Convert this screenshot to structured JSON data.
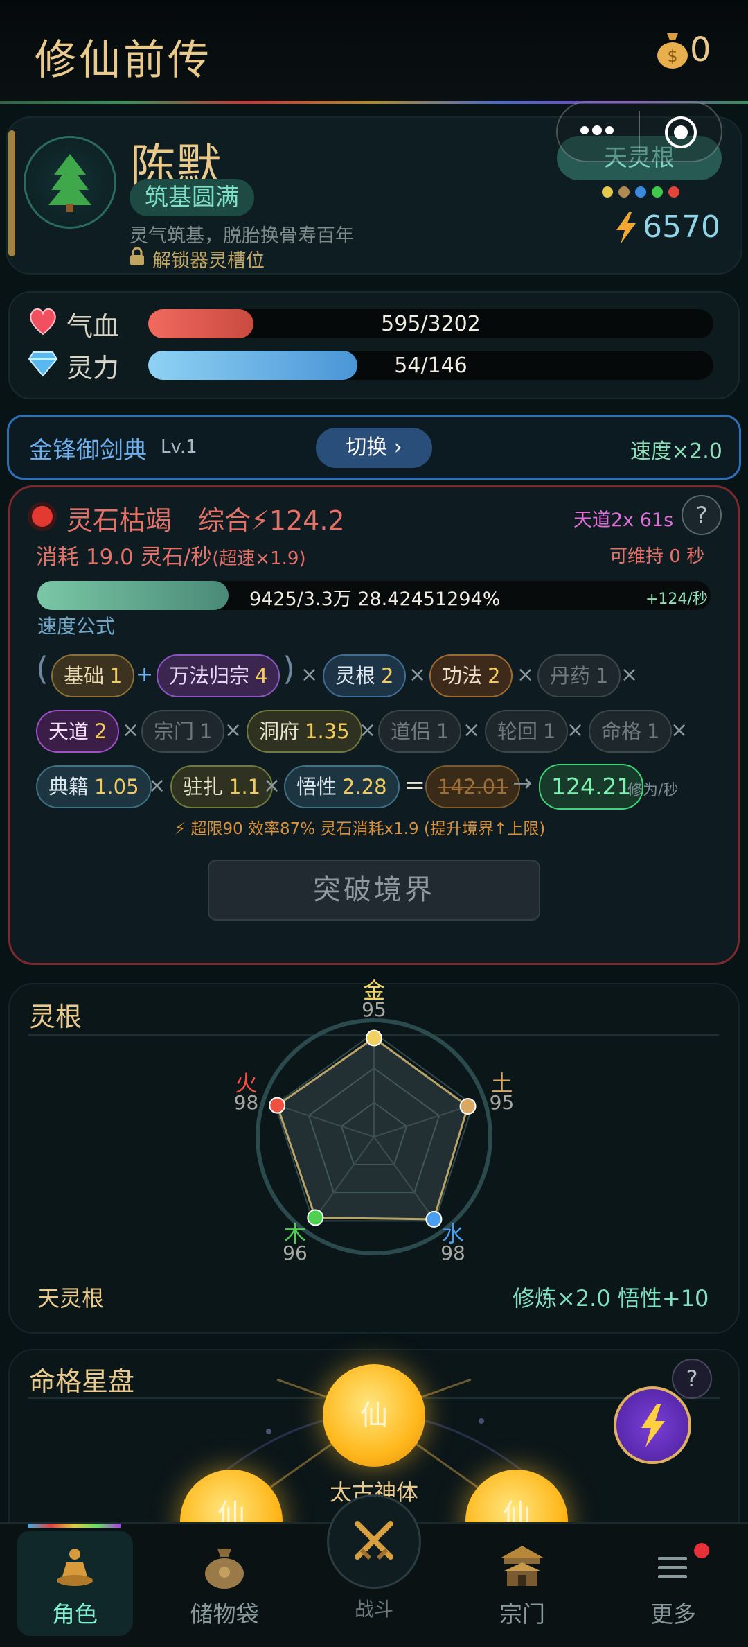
{
  "header": {
    "title": "修仙前传",
    "coins": "0",
    "coin_icon": "money-bag-icon"
  },
  "capsule": {
    "menu_icon": "more-dots-icon",
    "close_icon": "target-icon"
  },
  "character": {
    "name": "陈默",
    "realm": "筑基圆满",
    "realm_desc": "灵气筑基，脱胎换骨寿百年",
    "unlock_text": "解锁器灵槽位",
    "linggen_badge": "天灵根",
    "power": "6570",
    "element_dot_colors": [
      "#e6c84a",
      "#b08a50",
      "#3a8ae0",
      "#3fc84a",
      "#e0443a"
    ]
  },
  "stats": {
    "hp_label": "气血",
    "hp_value": "595/3202",
    "hp_ratio": 0.186,
    "mp_label": "灵力",
    "mp_value": "54/146",
    "mp_ratio": 0.37
  },
  "skill": {
    "name": "金锋御剑典",
    "level": "Lv.1",
    "switch_label": "切换 ›",
    "speed": "速度×2.0"
  },
  "cultivation": {
    "status": "灵石枯竭",
    "overall_label": "综合",
    "overall_value": "124.2",
    "tiandao_timer": "天道2x 61s",
    "help": "?",
    "consume_main": "消耗 19.0 灵石/秒",
    "consume_extra": "(超速×1.9)",
    "sustain": "可维持 0 秒",
    "progress_text": "9425/3.3万  28.42451294%",
    "progress_ratio": 0.2842,
    "rate": "+124/秒",
    "formula_label": "速度公式",
    "formula": {
      "open_paren": "(",
      "close_paren": ")",
      "plus": "+",
      "times": "×",
      "equals": "=",
      "arrow": "→",
      "jichu": {
        "label": "基础",
        "value": "1"
      },
      "wanfa": {
        "label": "万法归宗",
        "value": "4"
      },
      "linggen": {
        "label": "灵根",
        "value": "2"
      },
      "gongfa": {
        "label": "功法",
        "value": "2"
      },
      "danyao": {
        "label": "丹药",
        "value": "1"
      },
      "tiandao": {
        "label": "天道",
        "value": "2"
      },
      "zongmen": {
        "label": "宗门",
        "value": "1"
      },
      "dongfu": {
        "label": "洞府",
        "value": "1.35"
      },
      "daolv": {
        "label": "道侣",
        "value": "1"
      },
      "lunhui": {
        "label": "轮回",
        "value": "1"
      },
      "mingge": {
        "label": "命格",
        "value": "1"
      },
      "dianji": {
        "label": "典籍",
        "value": "1.05"
      },
      "zhuzha": {
        "label": "驻扎",
        "value": "1.1"
      },
      "wuxing": {
        "label": "悟性",
        "value": "2.28"
      },
      "raw_value": "142.01",
      "final_value": "124.21",
      "unit": "修为/秒"
    },
    "overlimit": "⚡ 超限90 效率87% 灵石消耗x1.9 (提升境界↑上限)",
    "breakthrough": "突破境界"
  },
  "linggen": {
    "title": "灵根",
    "elements": [
      {
        "name": "金",
        "value": 95,
        "color": "#f0d060"
      },
      {
        "name": "土",
        "value": 95,
        "color": "#d8a860"
      },
      {
        "name": "水",
        "value": 98,
        "color": "#4a9ef0"
      },
      {
        "name": "木",
        "value": 96,
        "color": "#50d050"
      },
      {
        "name": "火",
        "value": 98,
        "color": "#f05040"
      }
    ],
    "type": "天灵根",
    "bonus": "修炼×2.0  悟性+10"
  },
  "fate": {
    "title": "命格星盘",
    "help": "?",
    "main_star": "仙",
    "main_name": "太古神体",
    "left_star": "仙",
    "right_star": "仙"
  },
  "nav": {
    "items": [
      {
        "label": "角色",
        "icon": "meditating-figure-icon",
        "active": true
      },
      {
        "label": "储物袋",
        "icon": "storage-bag-icon",
        "active": false
      },
      {
        "label": "战斗",
        "icon": "crossed-swords-icon",
        "active": false
      },
      {
        "label": "宗门",
        "icon": "temple-icon",
        "active": false
      },
      {
        "label": "更多",
        "icon": "menu-lines-icon",
        "active": false
      }
    ]
  }
}
